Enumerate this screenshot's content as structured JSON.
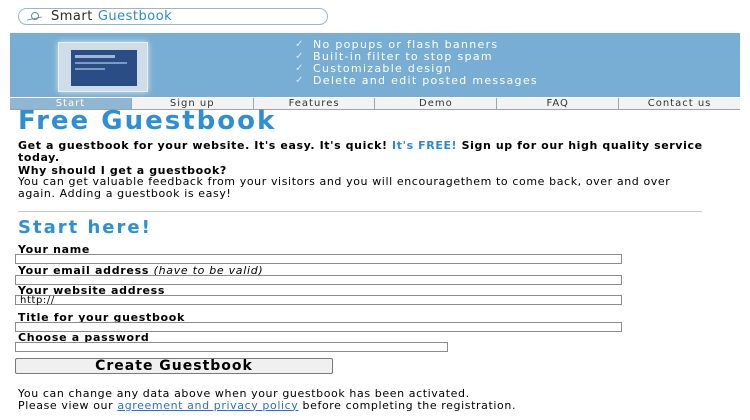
{
  "logo": {
    "word1": "Smart",
    "word2": "Guestbook"
  },
  "banner": {
    "features": [
      "No popups or flash banners",
      "Built-in filter to stop spam",
      "Customizable design",
      "Delete and edit posted messages"
    ]
  },
  "nav": {
    "tabs": [
      "Start",
      "Sign up",
      "Features",
      "Demo",
      "FAQ",
      "Contact us"
    ],
    "active": "Start"
  },
  "main": {
    "title": "Free Guestbook",
    "intro": "Get a guestbook for your website. It's easy. It's quick!",
    "intro_highlight": "It's FREE!",
    "intro_tail": "Sign up for our high quality service today.",
    "why_heading": "Why should I get a guestbook?",
    "why_text": "You can get valuable feedback from your visitors and you will encouragethem to come back, over and over again. Adding a guestbook is easy!"
  },
  "form": {
    "heading": "Start here!",
    "name_label": "Your name",
    "name_value": "",
    "email_label": "Your email address",
    "email_note": "(have to be valid)",
    "email_value": "",
    "website_label": "Your website address",
    "website_value": "http://",
    "gb_title_label": "Title for your guestbook",
    "gb_title_value": "",
    "password_label": "Choose a password",
    "password_value": "",
    "submit_label": "Create Guestbook"
  },
  "footer": {
    "line1": "You can change any data above when your guestbook has been activated.",
    "line2_pre": "Please view our",
    "policy_link": "agreement and privacy policy",
    "line2_post": "before completing the registration."
  }
}
